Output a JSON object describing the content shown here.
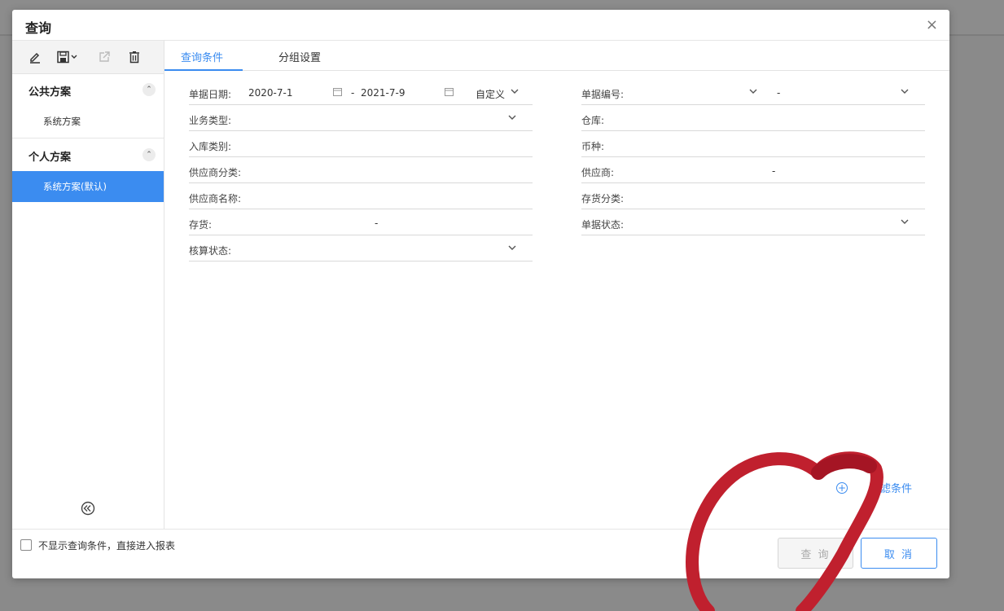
{
  "dialog": {
    "title": "查询",
    "close": "×"
  },
  "toolbar": {
    "icons": [
      "edit-icon",
      "save-icon",
      "export-icon",
      "delete-icon"
    ]
  },
  "plans": {
    "public": {
      "label": "公共方案",
      "items": [
        {
          "label": "系统方案"
        }
      ]
    },
    "personal": {
      "label": "个人方案",
      "items": [
        {
          "label": "系统方案(默认)",
          "active": true
        }
      ]
    }
  },
  "tabs": [
    {
      "label": "查询条件",
      "active": true
    },
    {
      "label": "分组设置"
    }
  ],
  "fields": {
    "bill_date": {
      "label": "单据日期:",
      "from": "2020-7-1",
      "sep": "-",
      "to": "2021-7-9",
      "mode": "自定义"
    },
    "bill_no": {
      "label": "单据编号:",
      "sep": "-"
    },
    "biz_type": {
      "label": "业务类型:"
    },
    "warehouse": {
      "label": "仓库:"
    },
    "in_category": {
      "label": "入库类别:"
    },
    "currency": {
      "label": "币种:"
    },
    "supplier_class": {
      "label": "供应商分类:"
    },
    "supplier": {
      "label": "供应商:",
      "sep": "-"
    },
    "supplier_name": {
      "label": "供应商名称:"
    },
    "stock_class": {
      "label": "存货分类:"
    },
    "stock": {
      "label": "存货:",
      "sep": "-"
    },
    "bill_status": {
      "label": "单据状态:"
    },
    "account_status": {
      "label": "核算状态:"
    }
  },
  "add_filter": {
    "label": "添加过滤条件",
    "visible_label": "过滤条件"
  },
  "footer": {
    "checkbox_label": "不显示查询条件，直接进入报表",
    "query_button": "查 询",
    "cancel_button": "取 消"
  },
  "colors": {
    "accent": "#3b8cf0",
    "annotation": "#c0202e"
  }
}
